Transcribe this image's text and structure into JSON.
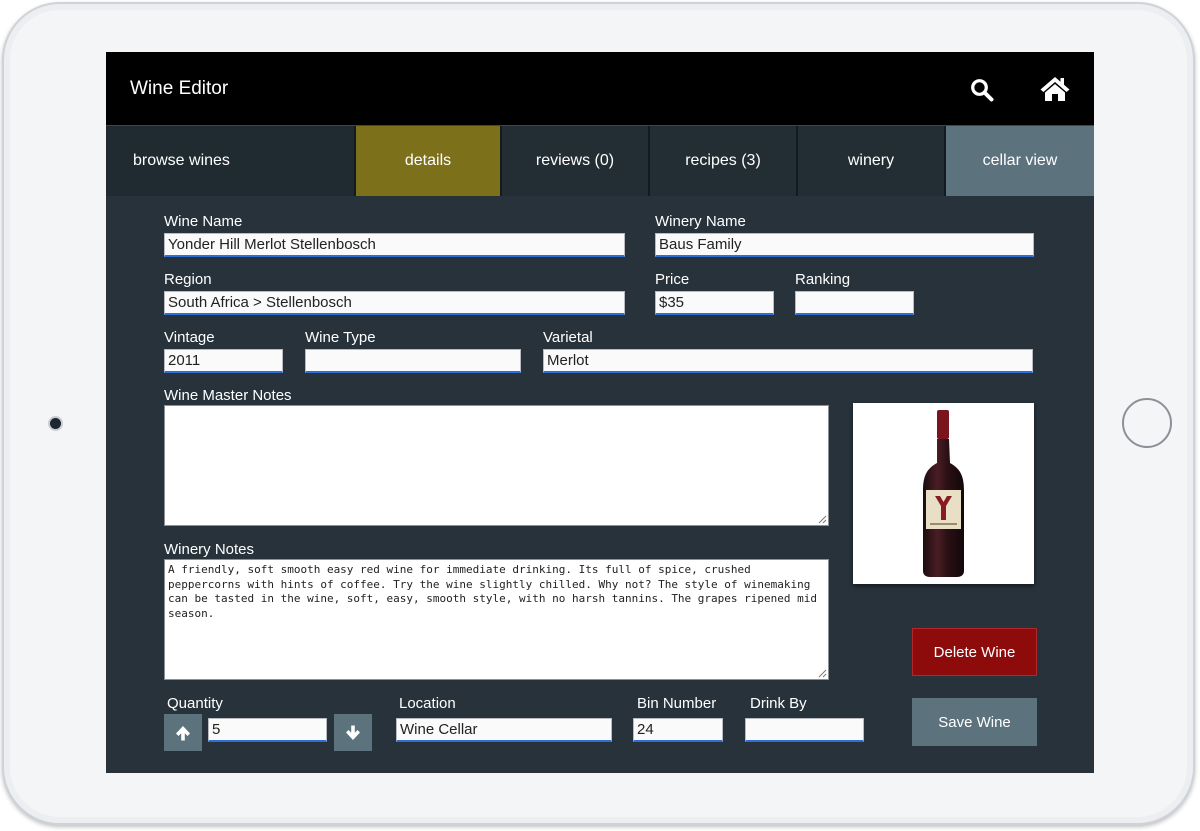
{
  "app": {
    "title": "Wine Editor"
  },
  "header_icons": {
    "search": "search-icon",
    "home": "home-icon"
  },
  "tabs": [
    {
      "label": "browse wines"
    },
    {
      "label": "details"
    },
    {
      "label": "reviews (0)"
    },
    {
      "label": "recipes (3)"
    },
    {
      "label": "winery"
    },
    {
      "label": "cellar view"
    }
  ],
  "form": {
    "wine_name": {
      "label": "Wine Name",
      "value": "Yonder Hill Merlot Stellenbosch"
    },
    "winery_name": {
      "label": "Winery Name",
      "value": "Baus Family"
    },
    "region": {
      "label": "Region",
      "value": "South Africa > Stellenbosch"
    },
    "price": {
      "label": "Price",
      "value": "$35"
    },
    "ranking": {
      "label": "Ranking",
      "value": ""
    },
    "vintage": {
      "label": "Vintage",
      "value": "2011"
    },
    "wine_type": {
      "label": "Wine Type",
      "value": ""
    },
    "varietal": {
      "label": "Varietal",
      "value": "Merlot"
    },
    "master_notes": {
      "label": "Wine Master Notes",
      "value": ""
    },
    "winery_notes": {
      "label": "Winery Notes",
      "value": "A friendly, soft smooth easy red wine for immediate drinking. Its full of spice, crushed peppercorns with hints of coffee. Try the wine slightly chilled. Why not? The style of winemaking can be tasted in the wine, soft, easy, smooth style, with no harsh tannins. The grapes ripened mid season."
    },
    "quantity": {
      "label": "Quantity",
      "value": "5"
    },
    "location": {
      "label": "Location",
      "value": "Wine Cellar"
    },
    "bin_number": {
      "label": "Bin Number",
      "value": "24"
    },
    "drink_by": {
      "label": "Drink By",
      "value": ""
    }
  },
  "buttons": {
    "delete": "Delete Wine",
    "save": "Save Wine"
  },
  "colors": {
    "active_tab": "#7d701b",
    "accent_tab": "#5c727d",
    "delete": "#8e0b0b",
    "background": "#27323a"
  }
}
